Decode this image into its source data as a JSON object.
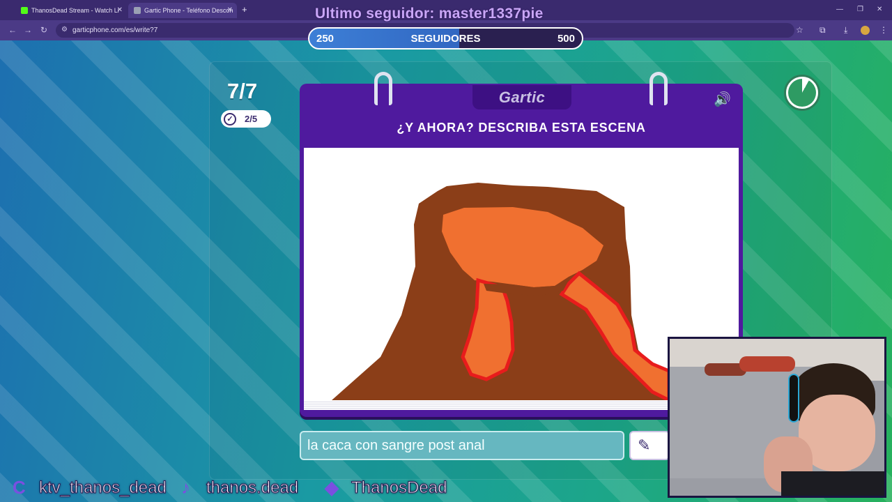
{
  "browser": {
    "tabs": [
      {
        "title": "ThanosDead Stream - Watch Li",
        "favicon_color": "#53fc18"
      },
      {
        "title": "Gartic Phone - Teléfono Descon",
        "favicon_color": "#9aa0b4"
      }
    ],
    "url": "garticphone.com/es/write?7"
  },
  "overlay": {
    "last_follower": "Ultimo seguidor: master1337pie",
    "goal_label": "SEGUIDORES",
    "goal_current": "250",
    "goal_target": "500",
    "goal_progress_fraction": 0.55
  },
  "game": {
    "round": "7/7",
    "players_done": "2/5",
    "logo": "Gartic",
    "instruction": "¿Y AHORA? DESCRIBA ESTA ESCENA",
    "answer_value": "la caca con sangre post anal",
    "timer_fraction_remaining": 0.92,
    "colors": {
      "accent": "#4f1a9e",
      "lava": "#f07030",
      "rock": "#8b3e18",
      "edge": "#e81c1c"
    }
  },
  "socials": {
    "kick": "ktv_thanos_dead",
    "tiktok": "thanos.dead",
    "twitch": "ThanosDead"
  },
  "icons": {
    "speaker": "speaker-icon",
    "pencil": "pencil-icon",
    "check": "check-icon"
  }
}
